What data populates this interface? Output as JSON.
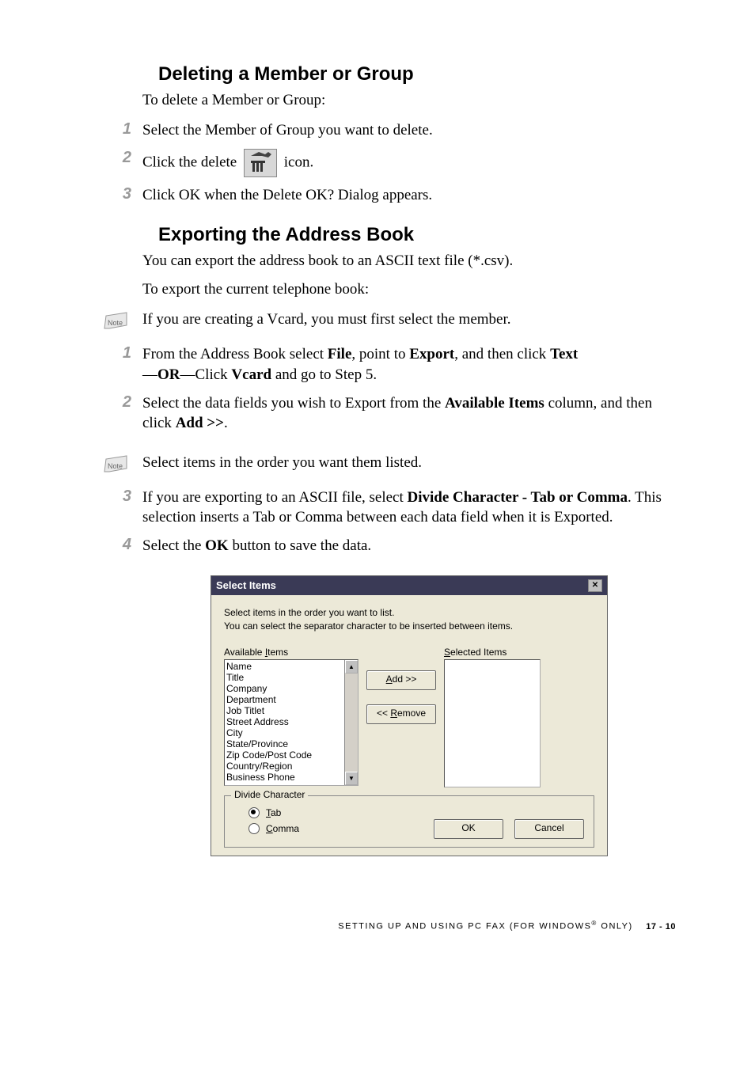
{
  "section1": {
    "heading": "Deleting a Member or Group",
    "intro": "To delete a Member or Group:",
    "steps": [
      "Select the Member of Group you want to delete.",
      {
        "prefix": "Click the delete ",
        "suffix": " icon."
      },
      "Click OK when the Delete OK? Dialog appears."
    ]
  },
  "section2": {
    "heading": "Exporting the Address Book",
    "intro1": "You can export the address book to an ASCII text file (*.csv).",
    "intro2": "To export the current telephone book:",
    "note1": "If you are creating a Vcard, you must first select the member.",
    "step1": {
      "text_before": "From the Address Book select ",
      "bold1": "File",
      "mid1": ", point to ",
      "bold2": "Export",
      "mid2": ", and then click ",
      "bold3": "Text",
      "line2_before": "—",
      "bold4": "OR",
      "line2_mid": "—Click ",
      "bold5": "Vcard",
      "line2_after": " and go to Step 5."
    },
    "step2": {
      "text_before": "Select the data fields you wish to Export from the ",
      "bold1": "Available Items",
      "mid": " column, and then click ",
      "bold2": "Add >>",
      "after": "."
    },
    "note2": "Select items in the order you want them listed.",
    "step3": {
      "text_before": "If you are exporting to an ASCII file, select ",
      "bold1": "Divide Character - Tab or Comma",
      "after": ". This selection inserts a Tab or Comma between each data field when it is Exported."
    },
    "step4": {
      "text_before": "Select the ",
      "bold1": "OK",
      "after": " button to save the data."
    }
  },
  "dialog": {
    "title": "Select Items",
    "msg1": "Select items in the order you want to list.",
    "msg2": "You can select the separator character to be inserted between items.",
    "available_label": "Available Items",
    "selected_label": "Selected Items",
    "available_items": [
      "Name",
      "Title",
      "Company",
      "Department",
      "Job Titlet",
      "Street Address",
      "City",
      "State/Province",
      "Zip Code/Post Code",
      "Country/Region",
      "Business Phone"
    ],
    "add_btn": "Add >>",
    "remove_btn": "<< Remove",
    "divide_legend": "Divide Character",
    "radio_tab": "Tab",
    "radio_comma": "Comma",
    "ok_btn": "OK",
    "cancel_btn": "Cancel"
  },
  "footer": {
    "text": "SETTING UP AND USING PC FAX (FOR WINDOWS",
    "reg": "®",
    "text2": " ONLY)",
    "page": "17 - 10"
  }
}
